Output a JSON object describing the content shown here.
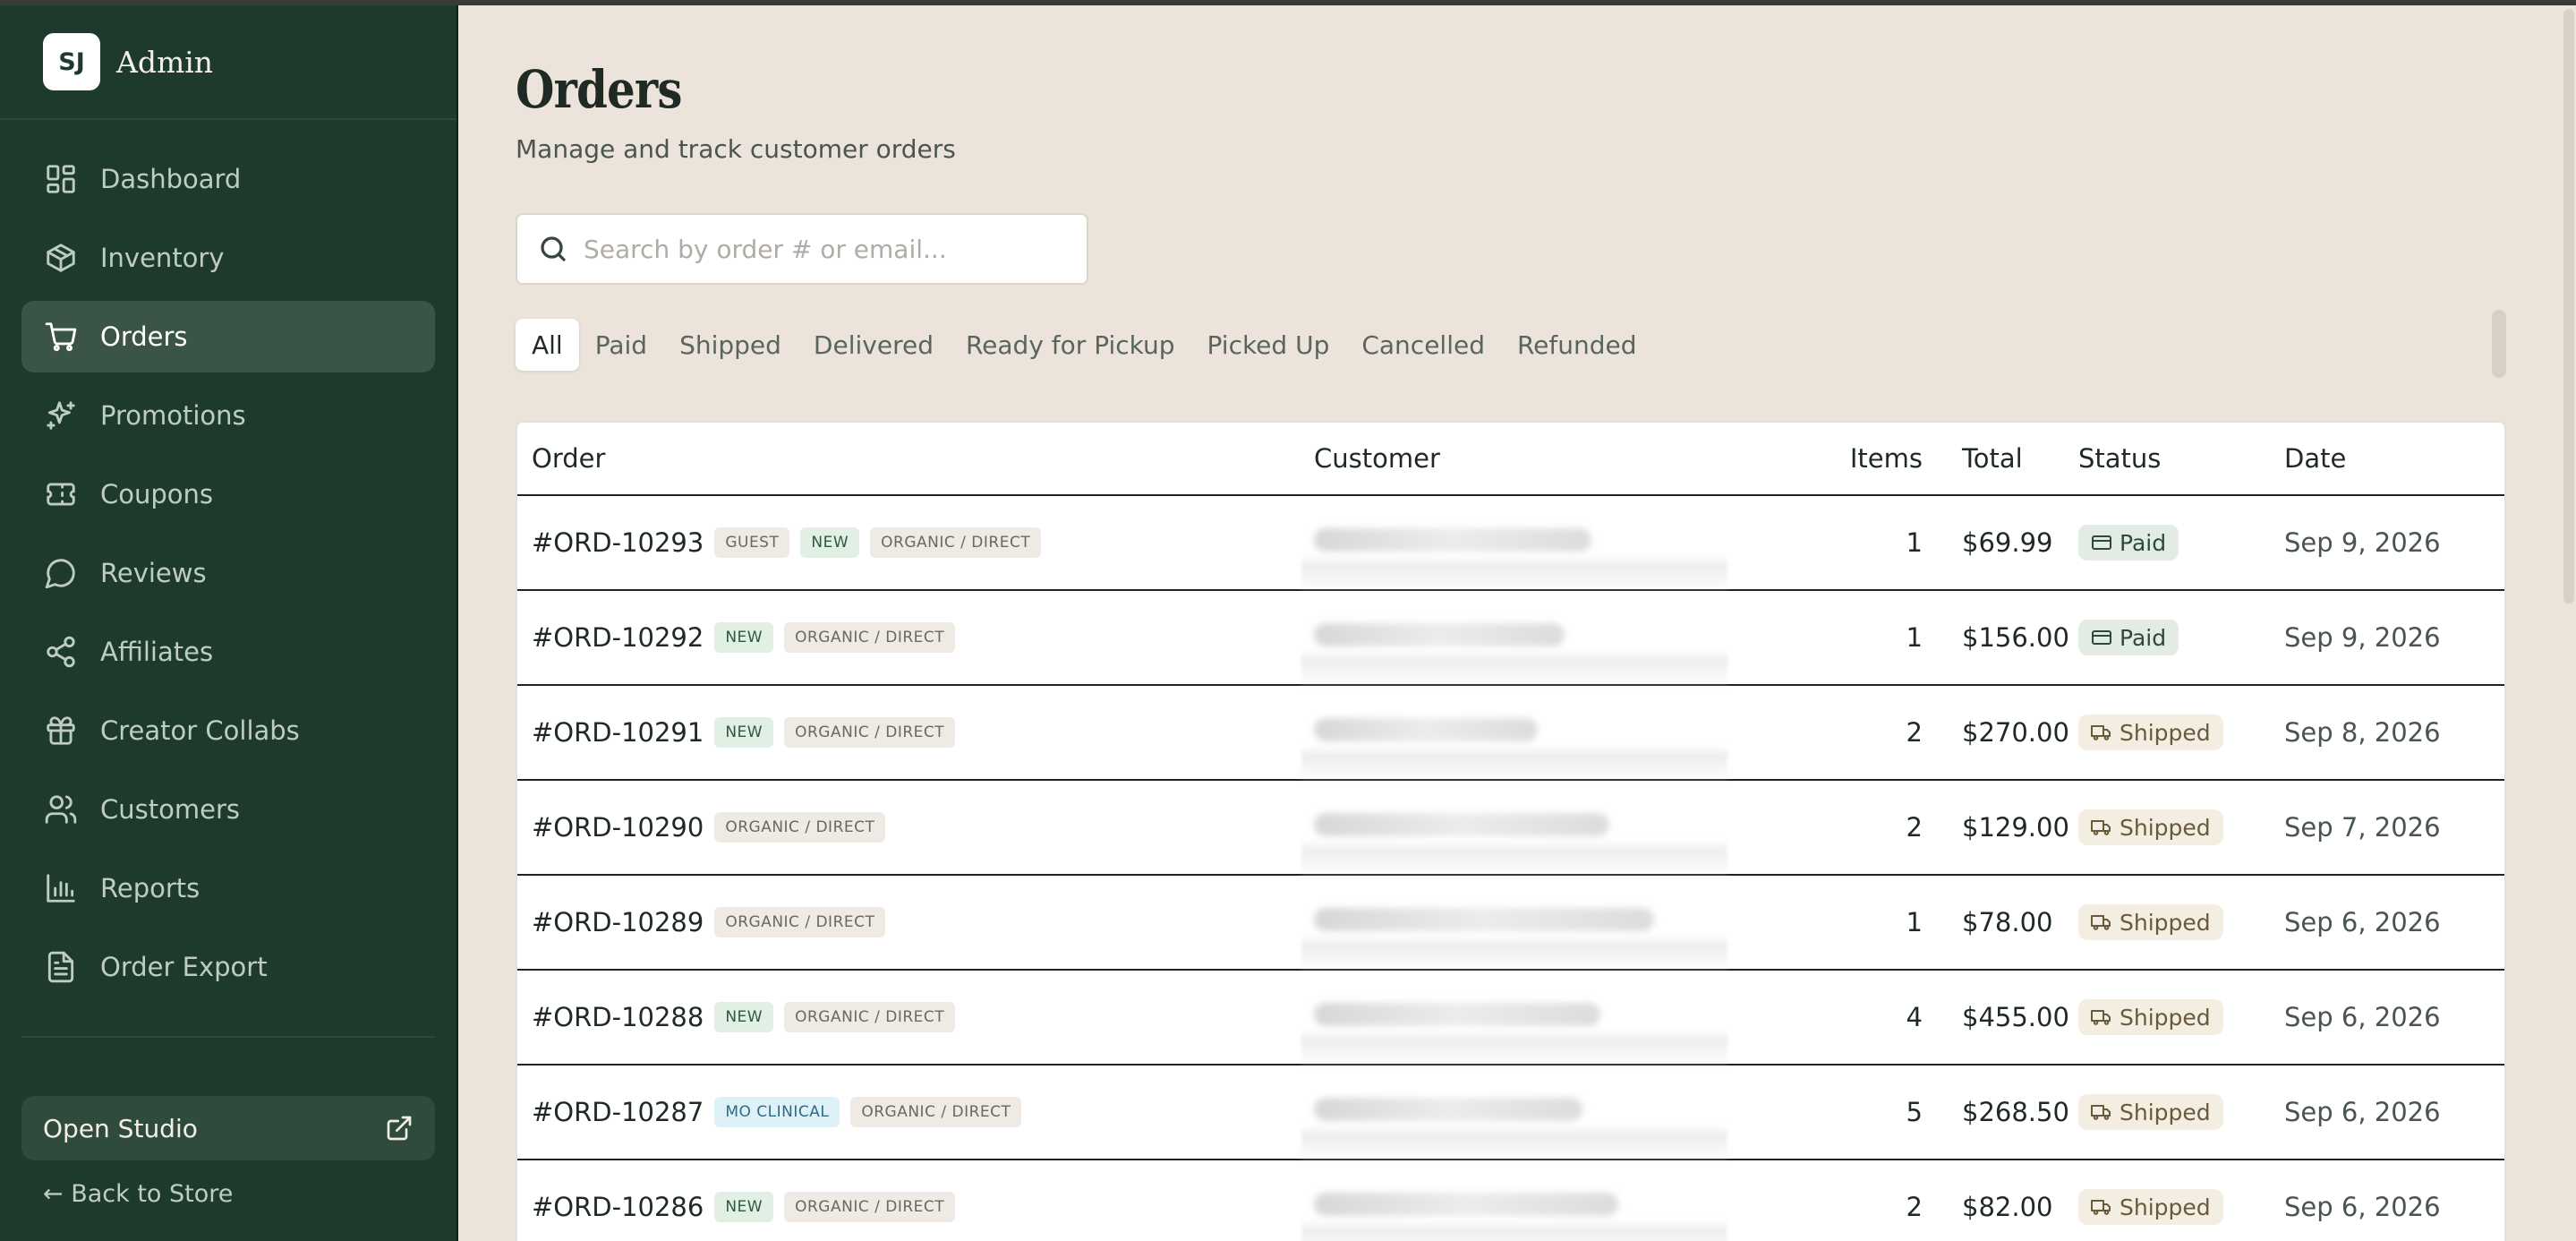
{
  "brand": {
    "initials": "SJ",
    "name": "Admin"
  },
  "sidebar": {
    "items": [
      {
        "label": "Dashboard",
        "icon": "dashboard-icon"
      },
      {
        "label": "Inventory",
        "icon": "box-icon"
      },
      {
        "label": "Orders",
        "icon": "cart-icon",
        "active": true
      },
      {
        "label": "Promotions",
        "icon": "sparkles-icon"
      },
      {
        "label": "Coupons",
        "icon": "ticket-icon"
      },
      {
        "label": "Reviews",
        "icon": "chat-icon"
      },
      {
        "label": "Affiliates",
        "icon": "share-icon"
      },
      {
        "label": "Creator Collabs",
        "icon": "gift-icon"
      },
      {
        "label": "Customers",
        "icon": "users-icon"
      },
      {
        "label": "Reports",
        "icon": "bar-chart-icon"
      },
      {
        "label": "Order Export",
        "icon": "file-icon"
      }
    ],
    "studio_label": "Open Studio",
    "back_label": "← Back to Store"
  },
  "page": {
    "title": "Orders",
    "subtitle": "Manage and track customer orders"
  },
  "search": {
    "placeholder": "Search by order # or email...",
    "value": ""
  },
  "tabs": [
    "All",
    "Paid",
    "Shipped",
    "Delivered",
    "Ready for Pickup",
    "Picked Up",
    "Cancelled",
    "Refunded"
  ],
  "active_tab": "All",
  "table": {
    "headers": {
      "order": "Order",
      "customer": "Customer",
      "items": "Items",
      "total": "Total",
      "status": "Status",
      "date": "Date"
    },
    "rows": [
      {
        "order": "#ORD-10293",
        "badges": [
          "GUEST",
          "NEW",
          "ORGANIC / DIRECT"
        ],
        "items": "1",
        "total": "$69.99",
        "status": "Paid",
        "date": "Sep 9, 2026"
      },
      {
        "order": "#ORD-10292",
        "badges": [
          "NEW",
          "ORGANIC / DIRECT"
        ],
        "items": "1",
        "total": "$156.00",
        "status": "Paid",
        "date": "Sep 9, 2026"
      },
      {
        "order": "#ORD-10291",
        "badges": [
          "NEW",
          "ORGANIC / DIRECT"
        ],
        "items": "2",
        "total": "$270.00",
        "status": "Shipped",
        "date": "Sep 8, 2026"
      },
      {
        "order": "#ORD-10290",
        "badges": [
          "ORGANIC / DIRECT"
        ],
        "items": "2",
        "total": "$129.00",
        "status": "Shipped",
        "date": "Sep 7, 2026"
      },
      {
        "order": "#ORD-10289",
        "badges": [
          "ORGANIC / DIRECT"
        ],
        "items": "1",
        "total": "$78.00",
        "status": "Shipped",
        "date": "Sep 6, 2026"
      },
      {
        "order": "#ORD-10288",
        "badges": [
          "NEW",
          "ORGANIC / DIRECT"
        ],
        "items": "4",
        "total": "$455.00",
        "status": "Shipped",
        "date": "Sep 6, 2026"
      },
      {
        "order": "#ORD-10287",
        "badges": [
          "MO CLINICAL",
          "ORGANIC / DIRECT"
        ],
        "items": "5",
        "total": "$268.50",
        "status": "Shipped",
        "date": "Sep 6, 2026"
      },
      {
        "order": "#ORD-10286",
        "badges": [
          "NEW",
          "ORGANIC / DIRECT"
        ],
        "items": "2",
        "total": "$82.00",
        "status": "Shipped",
        "date": "Sep 6, 2026"
      }
    ]
  },
  "colors": {
    "sidebar_bg": "#1e3a2c",
    "page_bg": "#ece4da",
    "active_nav": "#3a5547"
  }
}
